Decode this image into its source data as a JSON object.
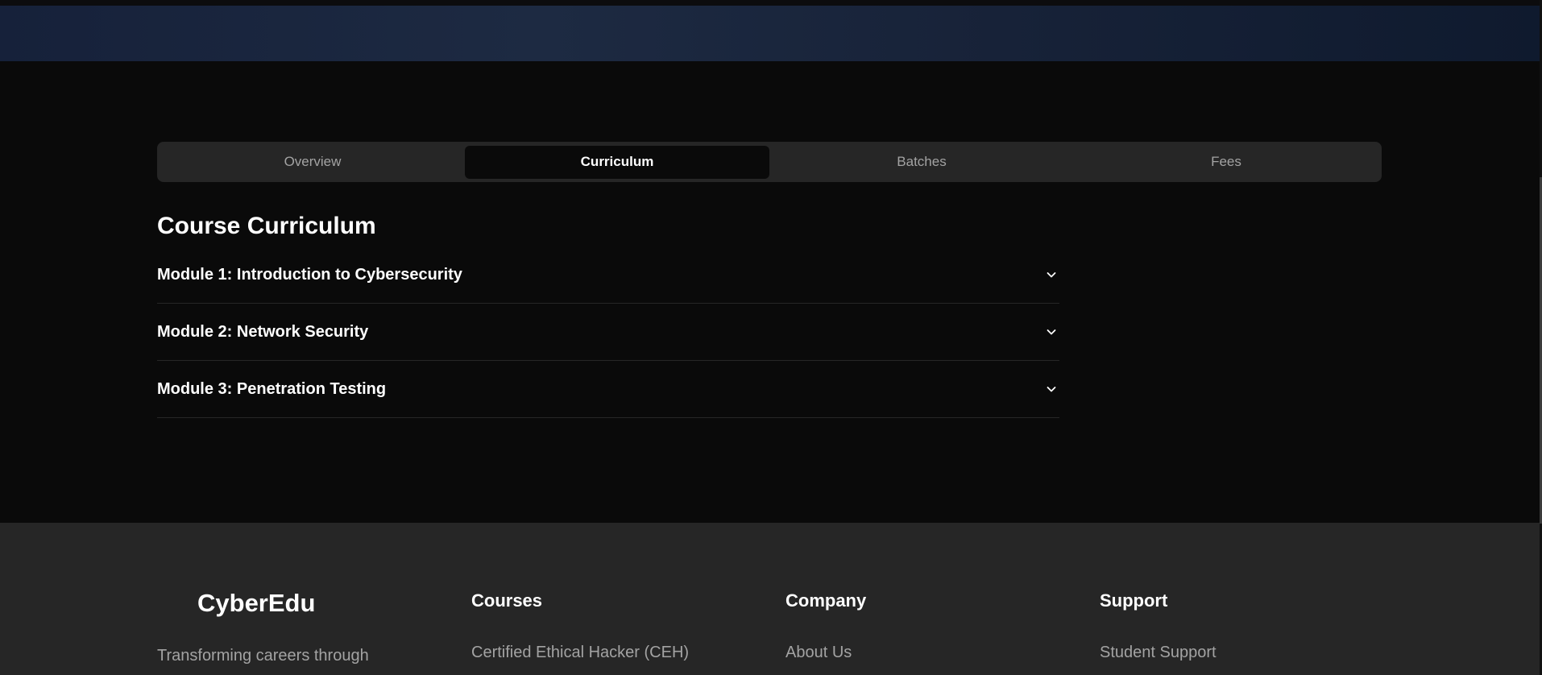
{
  "tabs": [
    {
      "label": "Overview"
    },
    {
      "label": "Curriculum"
    },
    {
      "label": "Batches"
    },
    {
      "label": "Fees"
    }
  ],
  "active_tab": "Curriculum",
  "curriculum": {
    "title": "Course Curriculum",
    "modules": [
      {
        "title": "Module 1: Introduction to Cybersecurity",
        "icon": "chevron-down-icon"
      },
      {
        "title": "Module 2: Network Security",
        "icon": "chevron-down-icon"
      },
      {
        "title": "Module 3: Penetration Testing",
        "icon": "chevron-down-icon"
      }
    ]
  },
  "footer": {
    "brand": "CyberEdu",
    "tagline": "Transforming careers through",
    "columns": [
      {
        "heading": "Courses",
        "links": [
          "Certified Ethical Hacker (CEH)"
        ]
      },
      {
        "heading": "Company",
        "links": [
          "About Us"
        ]
      },
      {
        "heading": "Support",
        "links": [
          "Student Support"
        ]
      }
    ]
  },
  "colors": {
    "background": "#0a0a0a",
    "tab_bar": "#262626",
    "footer": "#262626",
    "muted_text": "#a3a3a3",
    "hero_gradient": "#1d2a42"
  }
}
